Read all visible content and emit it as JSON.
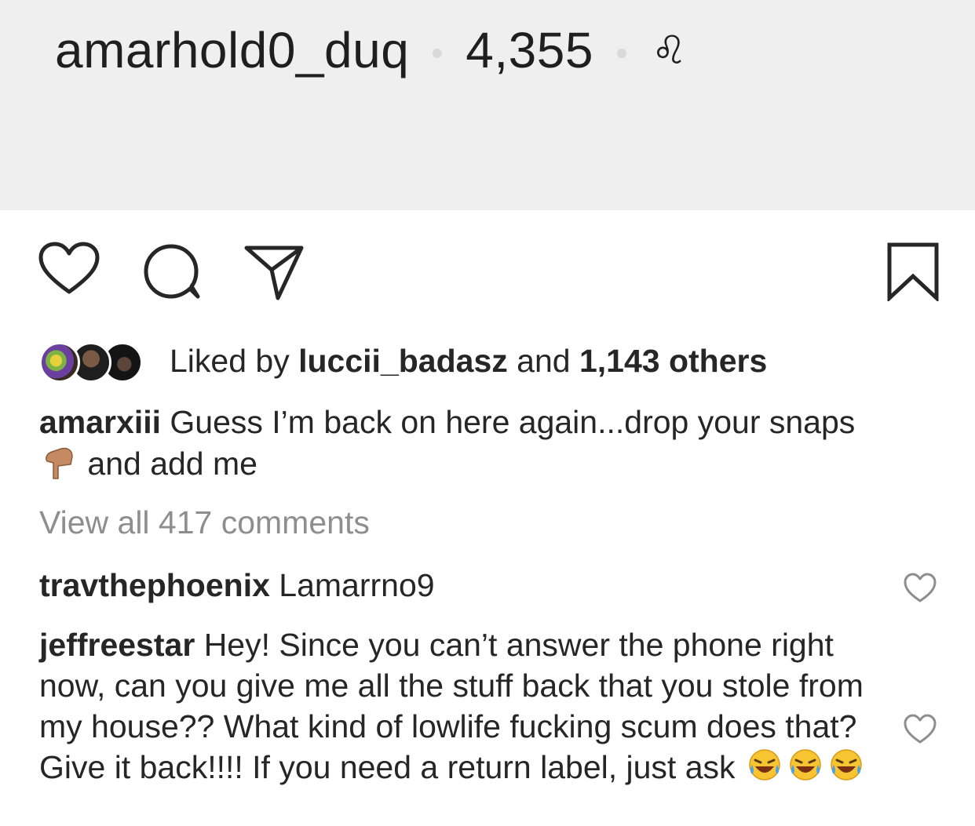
{
  "media": {
    "username": "amarhold0_duq",
    "count": "4,355",
    "zodiac_glyph": "♌",
    "background": "#efefef"
  },
  "actions": {
    "like_icon": "heart-icon",
    "comment_icon": "comment-icon",
    "share_icon": "paper-plane-icon",
    "save_icon": "bookmark-icon"
  },
  "likes": {
    "prefix": "Liked by",
    "user": "luccii_badasz",
    "middle": "and",
    "count_text": "1,143 others"
  },
  "caption": {
    "username": "amarxiii",
    "text_before": "Guess I’m back on here again...drop your snaps",
    "emoji": "point-down-emoji",
    "text_after": "and add me"
  },
  "view_all": "View all 417 comments",
  "comments": [
    {
      "username": "travthephoenix",
      "text": "Lamarrno9"
    },
    {
      "username": "jeffreestar",
      "text": "Hey! Since you can’t answer the phone right now, can you give me all the stuff back that you stole from my house?? What kind of lowlife fucking scum does that? Give it back!!!! If you need a return label, just ask",
      "emojis": [
        "laughing-tears-emoji",
        "laughing-tears-emoji",
        "laughing-tears-emoji"
      ]
    }
  ]
}
